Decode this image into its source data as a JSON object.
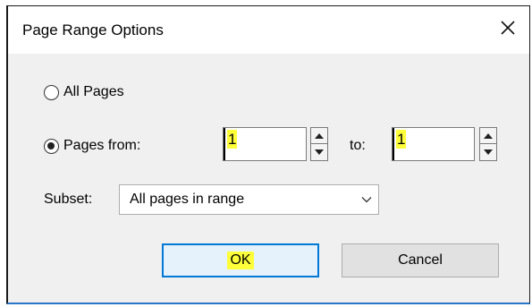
{
  "dialog": {
    "title": "Page Range Options",
    "close_glyph": "✕"
  },
  "range": {
    "all_pages_label": "All Pages",
    "pages_from_label": "Pages from:",
    "selected_option": "pages_from",
    "from_value": "1",
    "to_label": "to:",
    "to_value": "1"
  },
  "subset": {
    "label": "Subset:",
    "selected": "All pages in range"
  },
  "buttons": {
    "ok_label": "OK",
    "cancel_label": "Cancel"
  },
  "colors": {
    "highlight": "#ffff3a",
    "accent": "#0078d7",
    "dialog_bg": "#f0f0f0"
  },
  "icons": {
    "close": "close-icon",
    "spin_up": "triangle-up-icon",
    "spin_down": "triangle-down-icon",
    "dropdown": "chevron-down-icon"
  }
}
